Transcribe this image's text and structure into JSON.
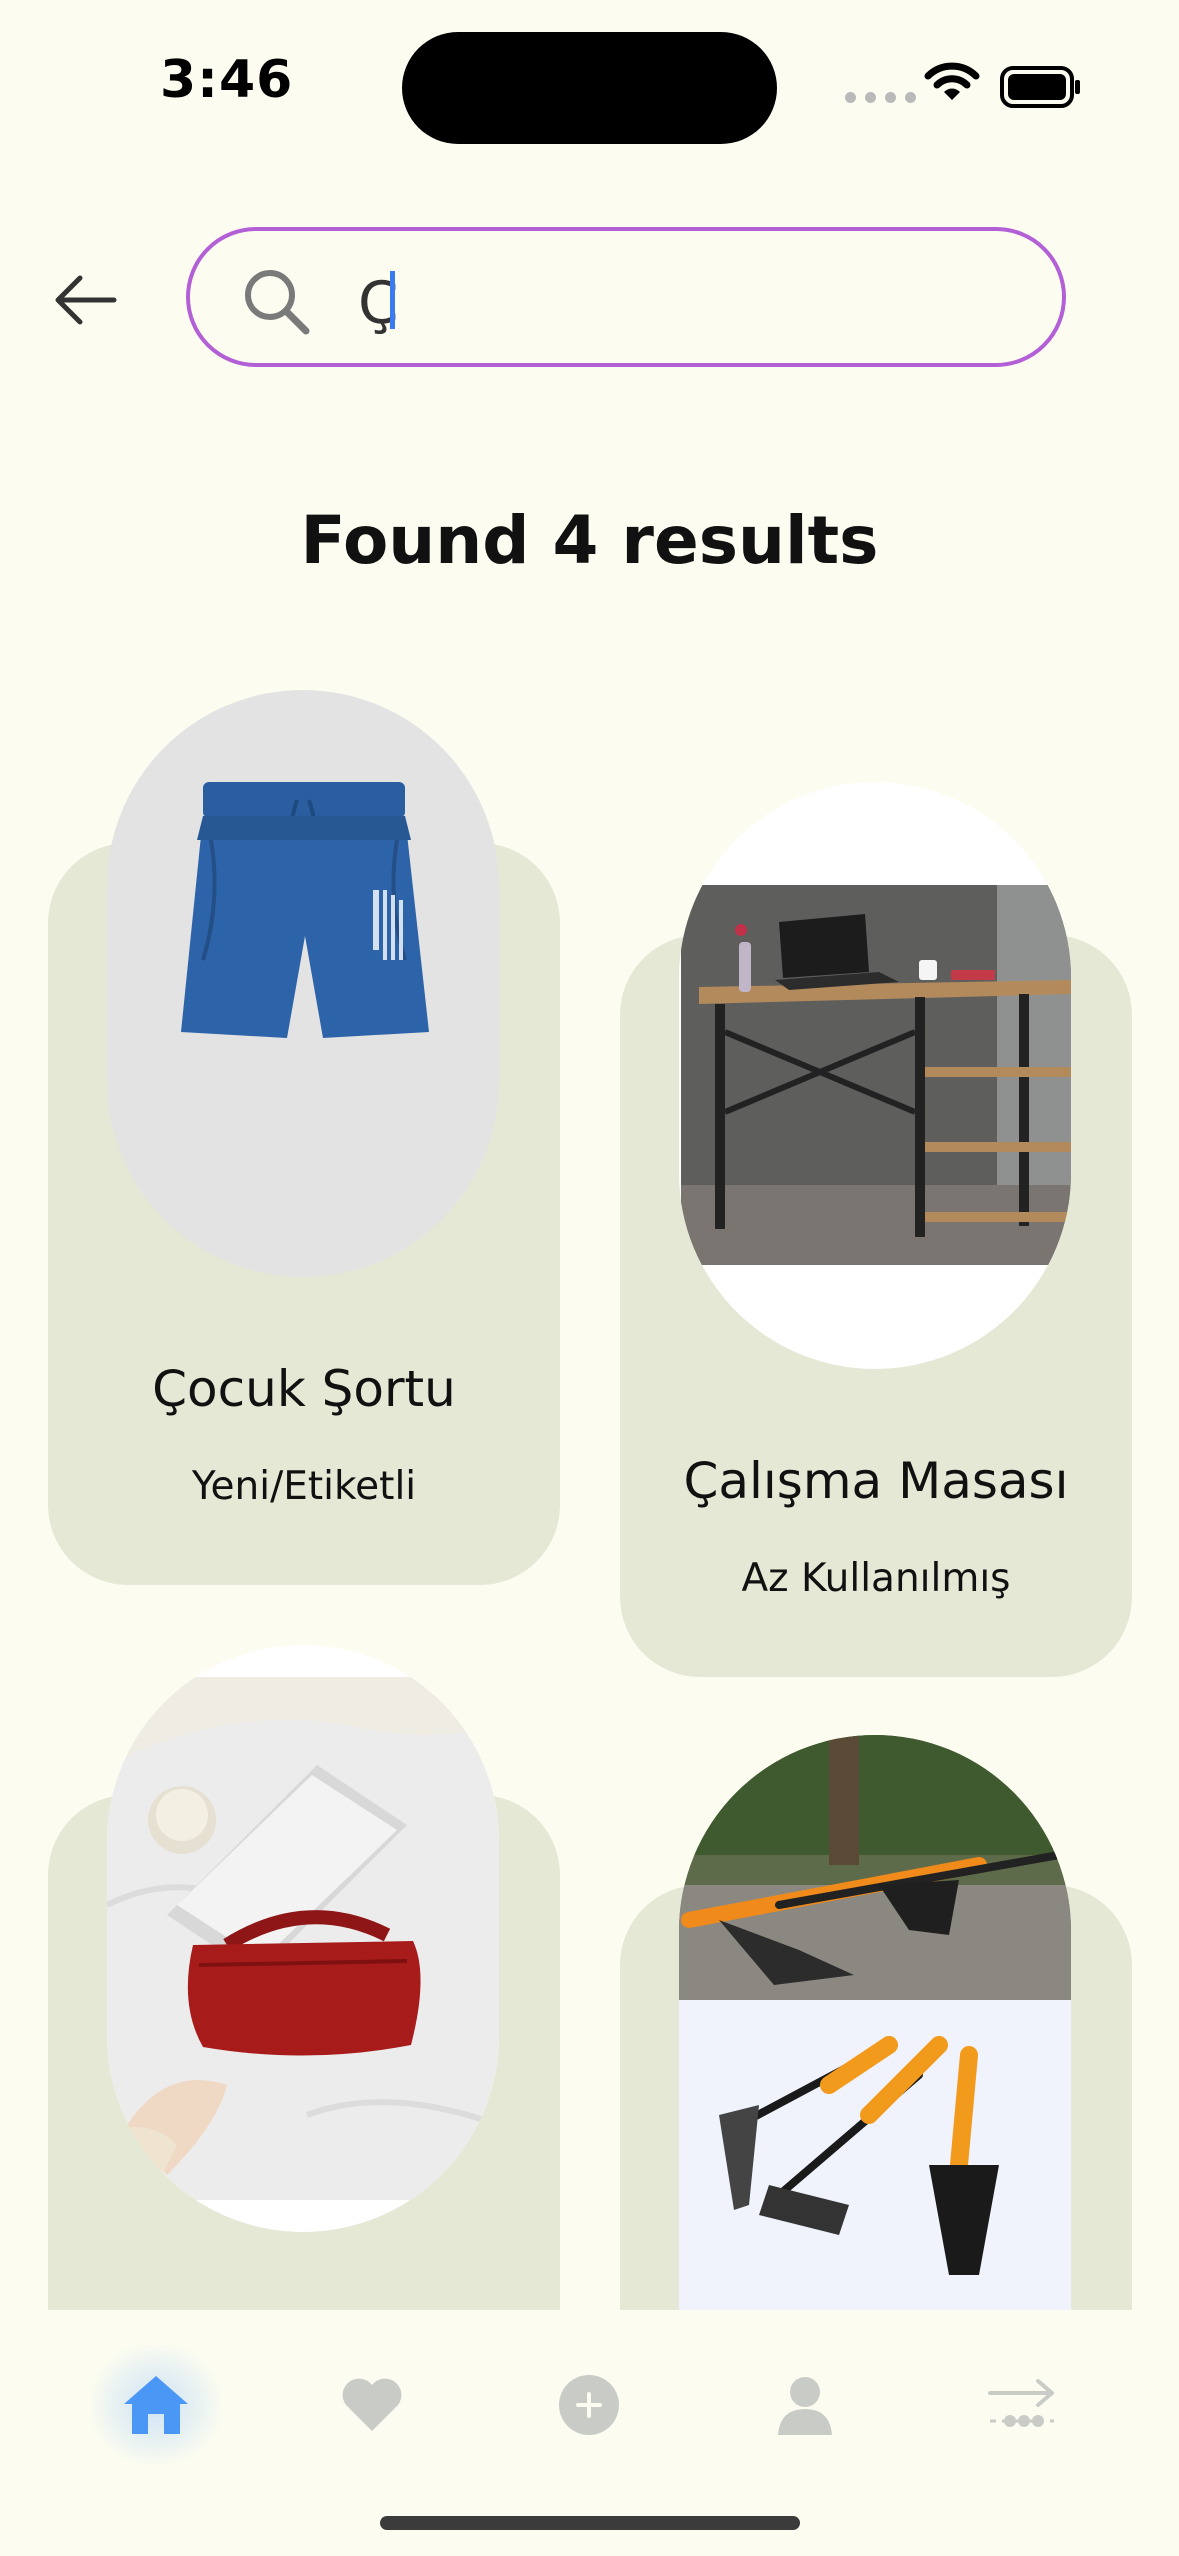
{
  "status_bar": {
    "time": "3:46"
  },
  "search": {
    "value": "Ç"
  },
  "results": {
    "heading": "Found 4 results"
  },
  "products": [
    {
      "title": "Çocuk Şortu",
      "condition": "Yeni/Etiketli",
      "image": "blue-shorts"
    },
    {
      "title": "Çalışma Masası",
      "condition": "Az Kullanılmış",
      "image": "work-desk"
    },
    {
      "title": "",
      "condition": "",
      "image": "red-handbag"
    },
    {
      "title": "",
      "condition": "",
      "image": "garden-tools"
    }
  ],
  "nav": {
    "items": [
      "home-icon",
      "heart-icon",
      "plus-icon",
      "user-icon",
      "logout-icon"
    ],
    "active": "home-icon",
    "active_color": "#4a97f5",
    "inactive_color": "#c9cbc6"
  },
  "colors": {
    "background": "#fcfdf0",
    "card": "#e6e8d6",
    "search_border": "#b35fd6"
  }
}
